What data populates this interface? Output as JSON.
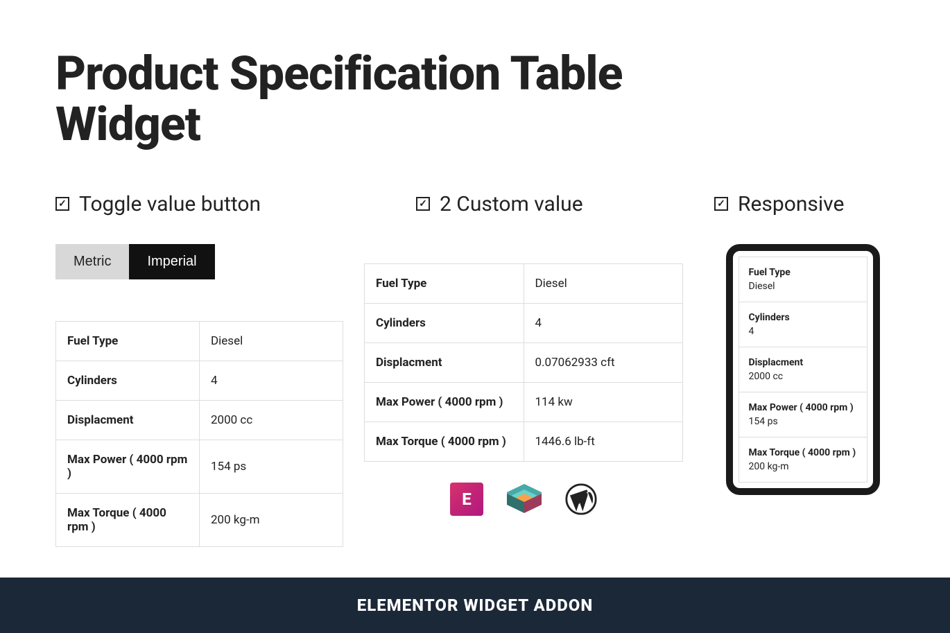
{
  "title": "Product Specification Table Widget",
  "features": [
    "Toggle value button",
    "2 Custom value",
    "Responsive"
  ],
  "toggle": {
    "metric": "Metric",
    "imperial": "Imperial"
  },
  "table_metric": [
    {
      "label": "Fuel Type",
      "value": "Diesel"
    },
    {
      "label": "Cylinders",
      "value": "4"
    },
    {
      "label": "Displacment",
      "value": "2000 cc"
    },
    {
      "label": "Max Power ( 4000 rpm )",
      "value": "154 ps"
    },
    {
      "label": "Max Torque ( 4000 rpm )",
      "value": "200 kg-m"
    }
  ],
  "table_imperial": [
    {
      "label": "Fuel Type",
      "value": "Diesel"
    },
    {
      "label": "Cylinders",
      "value": "4"
    },
    {
      "label": "Displacment",
      "value": "0.07062933 cft"
    },
    {
      "label": "Max Power ( 4000 rpm )",
      "value": "114 kw"
    },
    {
      "label": "Max Torque ( 4000 rpm )",
      "value": "1446.6 lb-ft"
    }
  ],
  "mobile_rows": [
    {
      "label": "Fuel Type",
      "value": "Diesel"
    },
    {
      "label": "Cylinders",
      "value": "4"
    },
    {
      "label": "Displacment",
      "value": "2000 cc"
    },
    {
      "label": "Max Power ( 4000 rpm )",
      "value": "154 ps"
    },
    {
      "label": "Max Torque ( 4000 rpm )",
      "value": "200 kg-m"
    }
  ],
  "logos": {
    "elementor": "E",
    "wordpress_title": "WordPress"
  },
  "footer": "ELEMENTOR WIDGET ADDON"
}
